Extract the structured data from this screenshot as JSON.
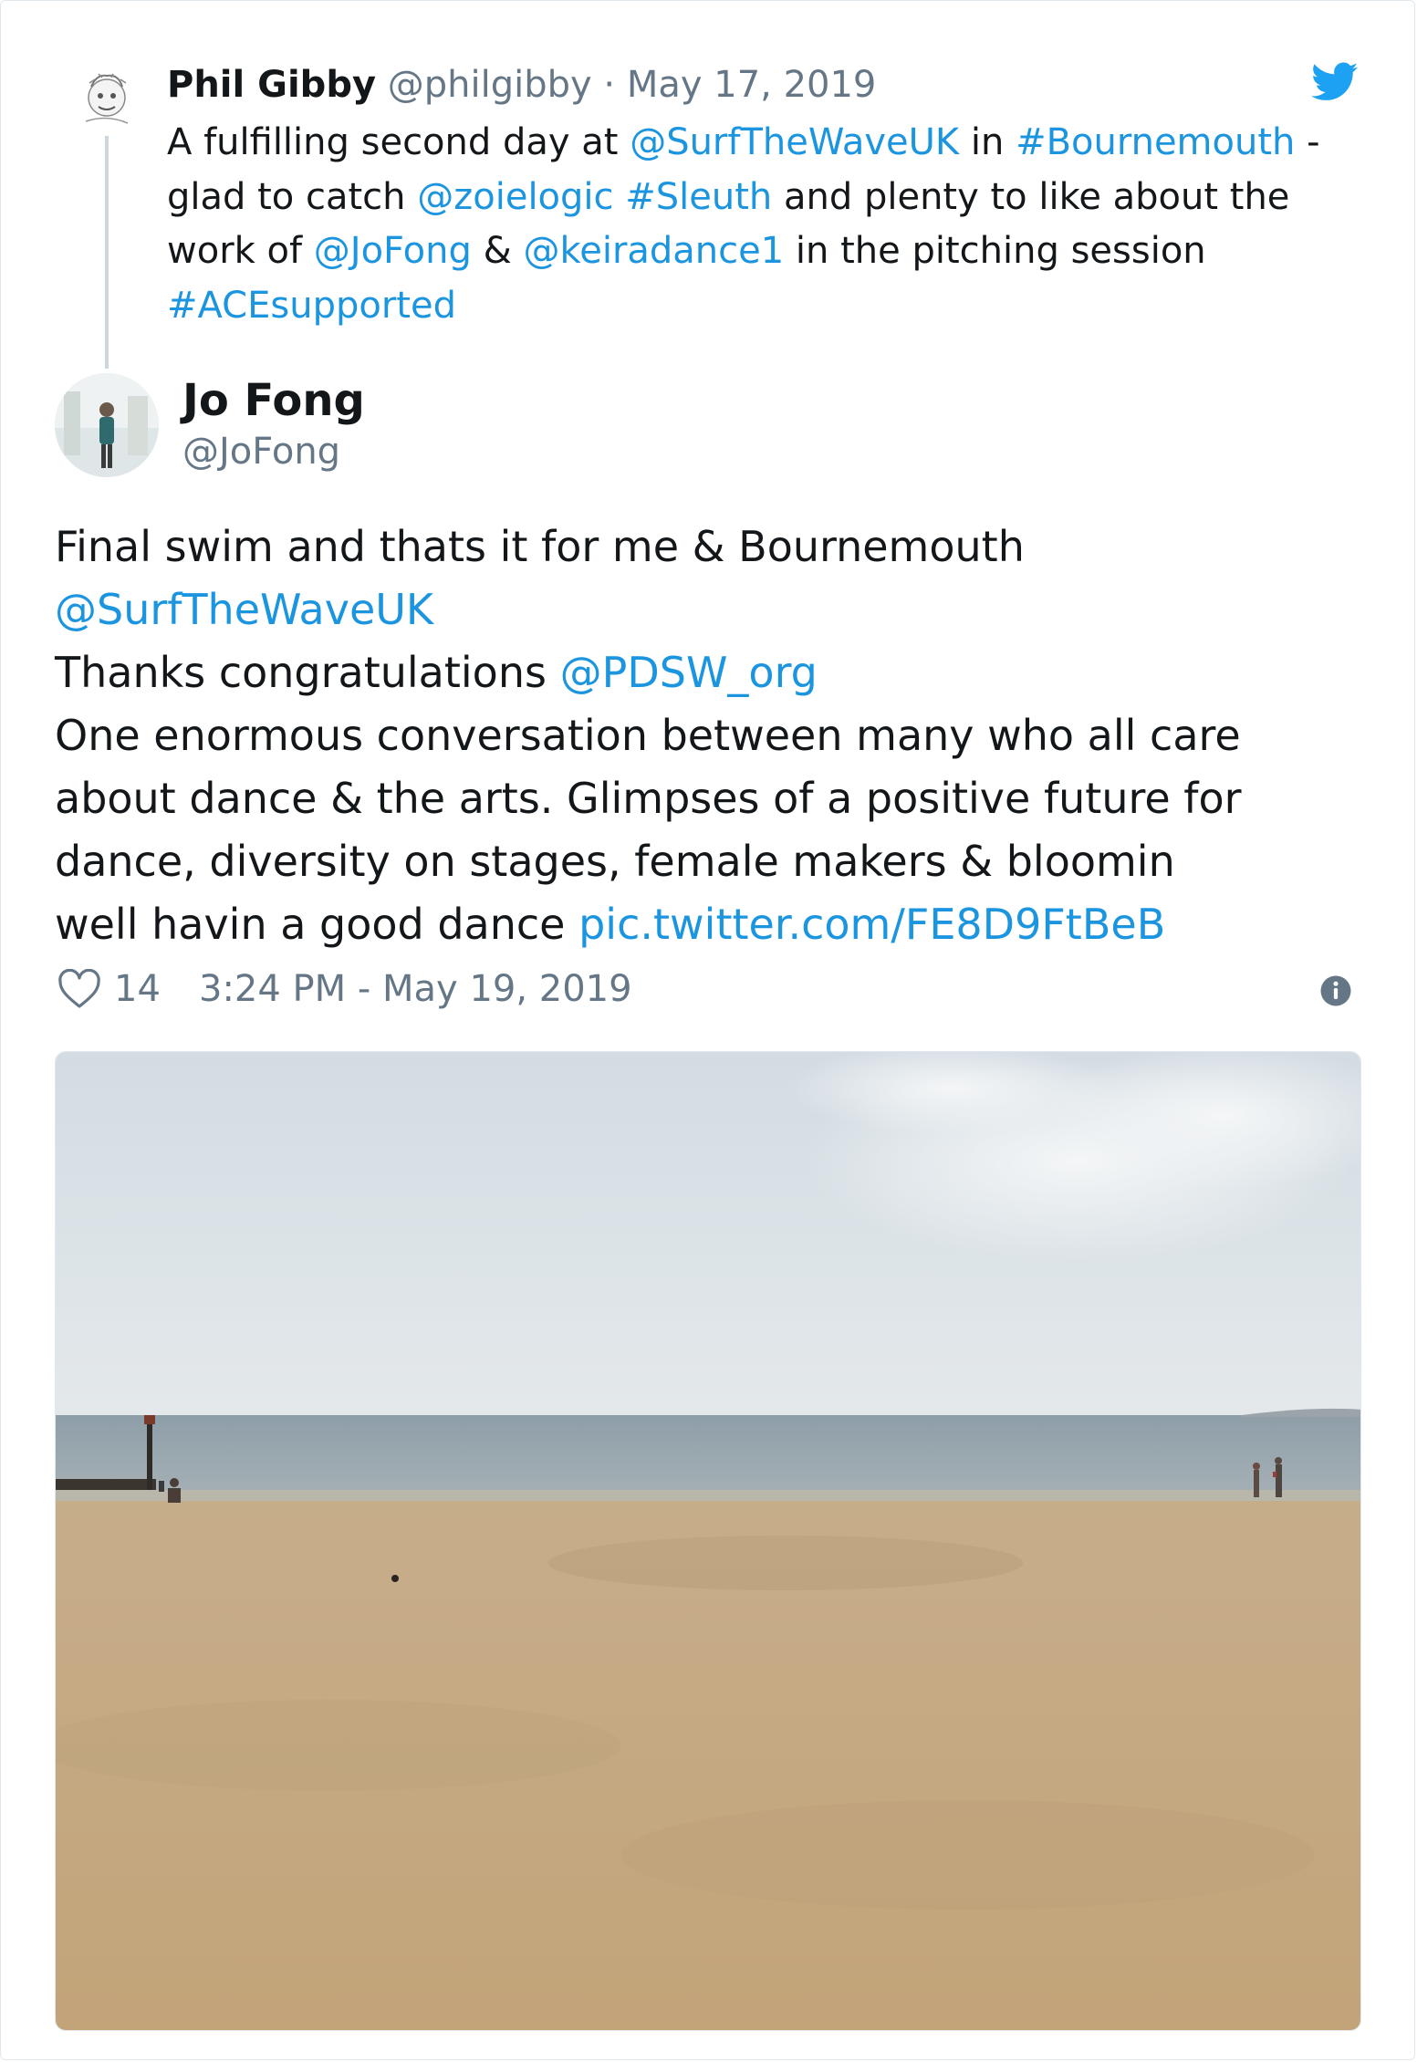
{
  "parent_tweet": {
    "author_name": "Phil Gibby",
    "handle": "@philgibby",
    "separator": "·",
    "date": "May 17, 2019",
    "text_parts": [
      {
        "t": "A fulfilling second day at "
      },
      {
        "t": "@SurfTheWaveUK",
        "link": true
      },
      {
        "t": " in "
      },
      {
        "t": "#Bournemouth",
        "link": true
      },
      {
        "t": " - glad to catch "
      },
      {
        "t": "@zoielogic",
        "link": true
      },
      {
        "t": " "
      },
      {
        "t": "#Sleuth",
        "link": true
      },
      {
        "t": " and plenty to like about the work of "
      },
      {
        "t": "@JoFong",
        "link": true
      },
      {
        "t": " & "
      },
      {
        "t": "@keiradance1",
        "link": true
      },
      {
        "t": " in the pitching session "
      },
      {
        "t": "#ACEsupported",
        "link": true
      }
    ]
  },
  "main_tweet": {
    "author_name": "Jo Fong",
    "handle": "@JoFong",
    "lines": [
      [
        {
          "t": "Final swim and thats it for me & Bournemouth"
        }
      ],
      [
        {
          "t": "@SurfTheWaveUK",
          "link": true
        }
      ],
      [
        {
          "t": "Thanks congratulations "
        },
        {
          "t": "@PDSW_org",
          "link": true
        }
      ],
      [
        {
          "t": "One enormous conversation between many who all care"
        }
      ],
      [
        {
          "t": "about dance & the arts. Glimpses of a positive future for"
        }
      ],
      [
        {
          "t": "dance, diversity on stages, female makers & bloomin"
        }
      ],
      [
        {
          "t": "well havin a good dance "
        },
        {
          "t": "pic.twitter.com/FE8D9FtBeB",
          "link": true
        }
      ]
    ],
    "likes": "14",
    "timestamp": "3:24 PM - May 19, 2019"
  },
  "icons": {
    "brand": "twitter-bird-icon",
    "like": "heart-icon",
    "info": "info-icon"
  },
  "colors": {
    "link": "#1b95e0",
    "text": "#14171a",
    "muted": "#657786",
    "thread_line": "#ccd6dd"
  }
}
